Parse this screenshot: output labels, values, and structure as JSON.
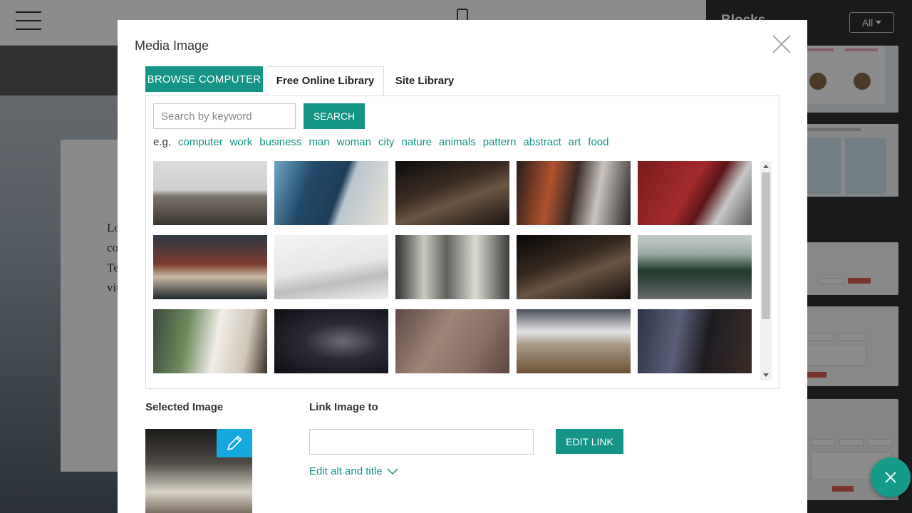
{
  "background": {
    "blocks_title": "Blocks",
    "filter_label": "All",
    "card_text_lines": [
      "Lo",
      "co",
      "Te",
      "vit"
    ]
  },
  "modal": {
    "title": "Media Image",
    "browse_label": "BROWSE COMPUTER",
    "tabs": [
      "Free Online Library",
      "Site Library"
    ],
    "active_tab": "Free Online Library",
    "search": {
      "placeholder": "Search by keyword",
      "value": "",
      "button_label": "SEARCH"
    },
    "suggestions_prefix": "e.g.",
    "suggestions": [
      "computer",
      "work",
      "business",
      "man",
      "woman",
      "city",
      "nature",
      "animals",
      "pattern",
      "abstract",
      "art",
      "food"
    ],
    "images": [
      {
        "name": "boardwalk-fog-image",
        "bg": "linear-gradient(180deg,#dcdcdc 0%,#cfcfcf 45%,#7a746c 55%,#3b3530 100%)"
      },
      {
        "name": "glass-skyscrapers-image",
        "bg": "linear-gradient(110deg,#6ea6c6 0%,#234a6a 30%,#1d3e5a 55%,#b9c6cf 62%,#e8e2d6 100%)"
      },
      {
        "name": "cave-hiker-image",
        "bg": "linear-gradient(160deg,#0d0b0a 0%,#3a2c22 40%,#6b5442 60%,#1a1410 100%)"
      },
      {
        "name": "city-lights-reflection-image",
        "bg": "linear-gradient(100deg,#2a1e1a 0%,#b0522e 30%,#3a2a24 50%,#c9c4bf 70%,#2b2623 100%)"
      },
      {
        "name": "red-building-facade-image",
        "bg": "linear-gradient(120deg,#7a1c1e 0%,#a52a2a 45%,#5b1518 60%,#c7c7c7 75%,#5a5a5a 100%)"
      },
      {
        "name": "vintage-radio-image",
        "bg": "linear-gradient(180deg,#2c3a44 0%,#7b3a2e 45%,#c9b9a3 65%,#1e262c 100%)"
      },
      {
        "name": "airplane-wing-image",
        "bg": "linear-gradient(170deg,#f4f4f4 0%,#e6e6e6 50%,#bdbdbd 70%,#efefef 100%)"
      },
      {
        "name": "skyscraper-aerial-image",
        "bg": "linear-gradient(90deg,#2d302f 0%,#c7cabf 25%,#5e625c 45%,#d9dbd2 70%,#3b3e3a 100%)"
      },
      {
        "name": "cave-hiker-image-2",
        "bg": "linear-gradient(160deg,#0a0908 0%,#35291f 40%,#6a5341 60%,#140f0c 100%)"
      },
      {
        "name": "forest-road-image",
        "bg": "linear-gradient(180deg,#c4ccc8 0%,#9aa8a2 30%,#1f3a2a 55%,#3d4a44 75%,#6a6e6a 100%)"
      },
      {
        "name": "cafe-laptop-image",
        "bg": "linear-gradient(100deg,#3a4a3a 0%,#6e8a5e 30%,#f0ede6 55%,#d0c6b8 80%,#3a3026 100%)"
      },
      {
        "name": "milky-way-image",
        "bg": "radial-gradient(ellipse at 60% 50%,#6b6b74 0%,#2a2a34 40%,#0e0e14 100%)"
      },
      {
        "name": "pink-pavement-image",
        "bg": "linear-gradient(120deg,#5e4a44 0%,#a08478 40%,#8a6e64 70%,#5a4640 100%)"
      },
      {
        "name": "snowy-field-image",
        "bg": "linear-gradient(180deg,#4a5058 0%,#e4e4e6 35%,#a89a86 55%,#6e5236 100%)"
      },
      {
        "name": "phone-photo-dusk-image",
        "bg": "linear-gradient(100deg,#2e3448 0%,#5a5e78 35%,#1e1c22 60%,#3a2c26 100%)"
      }
    ],
    "selected_label": "Selected Image",
    "selected_image_bg": "linear-gradient(180deg,#1c1a18 0%,#4e4a44 40%,#d8d2c6 75%,#7a6e62 100%)",
    "link_label": "Link Image to",
    "link_value": "",
    "edit_link_label": "EDIT LINK",
    "alt_title_label": "Edit alt and title"
  },
  "colors": {
    "accent": "#149486",
    "edit_icon_bg": "#15a9e0"
  }
}
